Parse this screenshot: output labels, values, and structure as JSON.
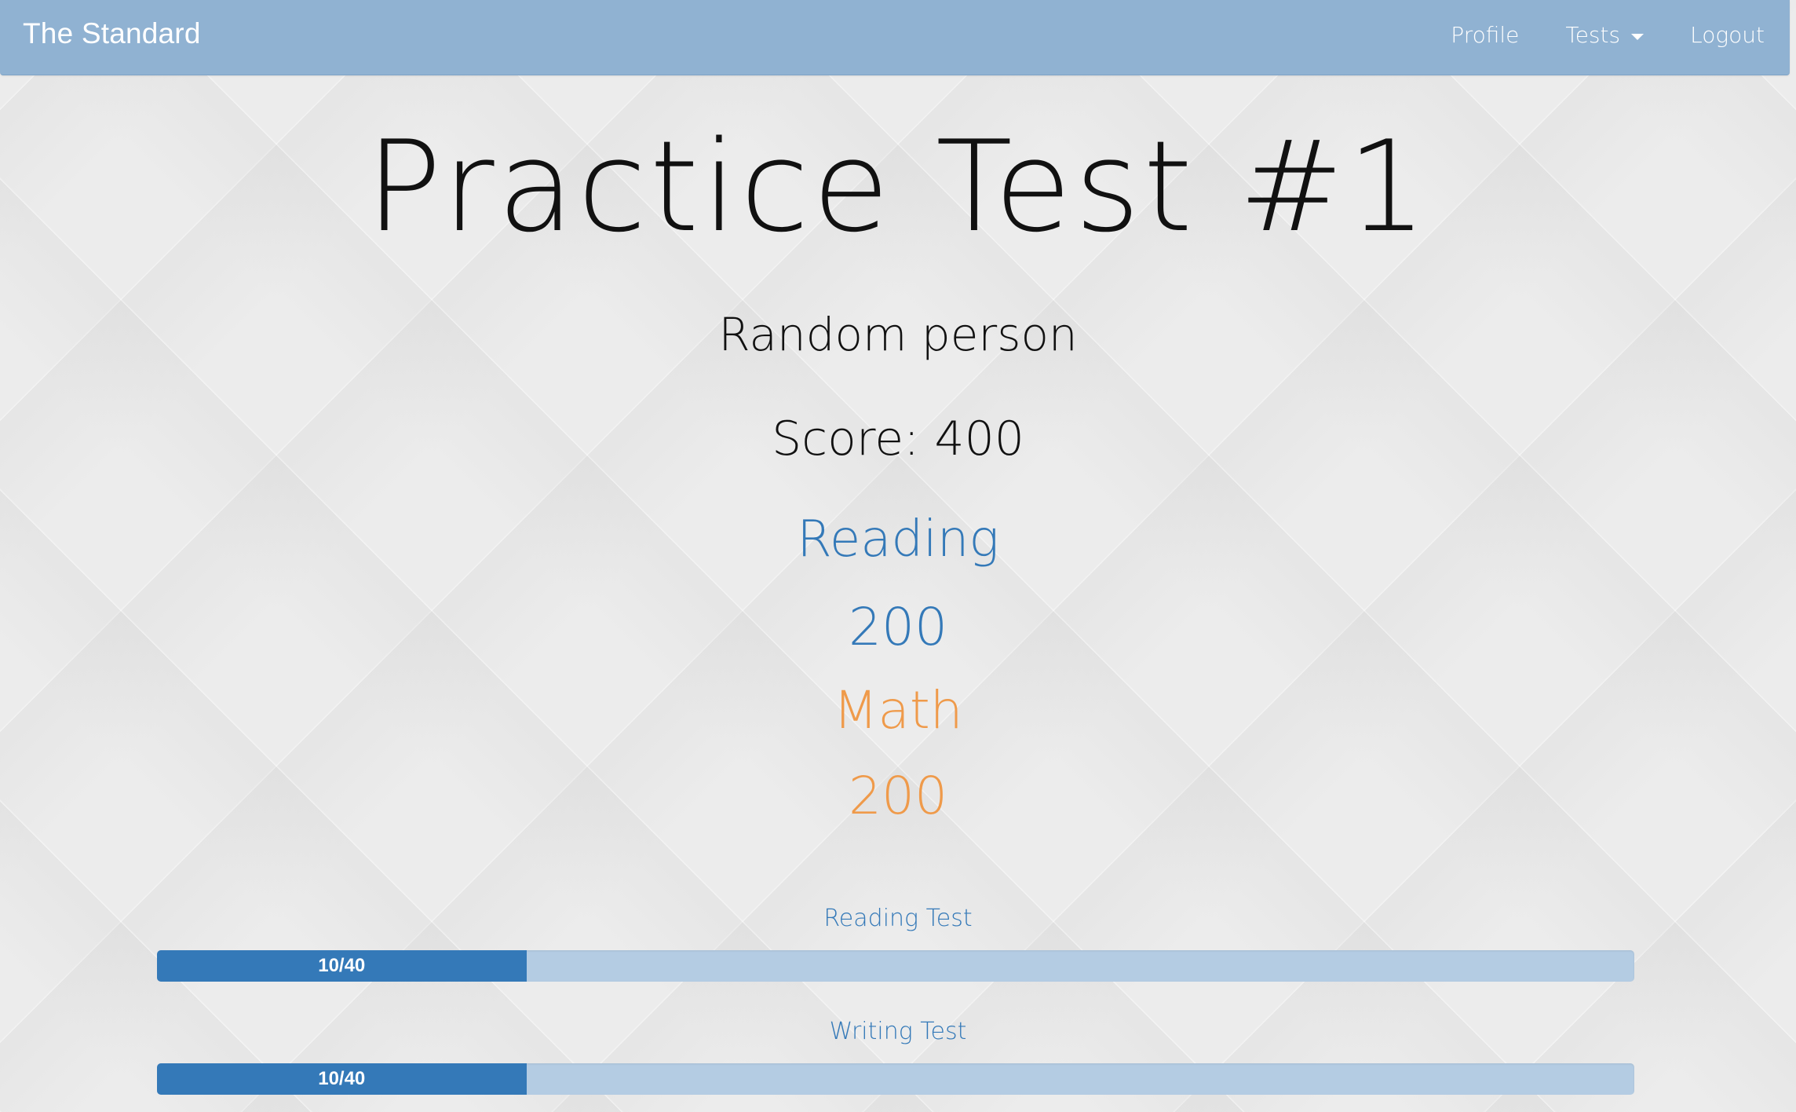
{
  "nav": {
    "brand": "The Standard",
    "profile": "Profile",
    "tests": "Tests",
    "logout": "Logout"
  },
  "main": {
    "title": "Practice Test #1",
    "person": "Random person",
    "score": "Score: 400",
    "reading": {
      "label": "Reading",
      "score": "200"
    },
    "math": {
      "label": "Math",
      "score": "200"
    }
  },
  "progress": [
    {
      "label": "Reading Test",
      "text": "10/40",
      "fraction": 0.25
    },
    {
      "label": "Writing Test",
      "text": "10/40",
      "fraction": 0.25
    }
  ],
  "colors": {
    "navbar": "#90b2d2",
    "reading": "#3479b8",
    "math": "#ef9a4a",
    "progress_track": "#b4cce3"
  }
}
